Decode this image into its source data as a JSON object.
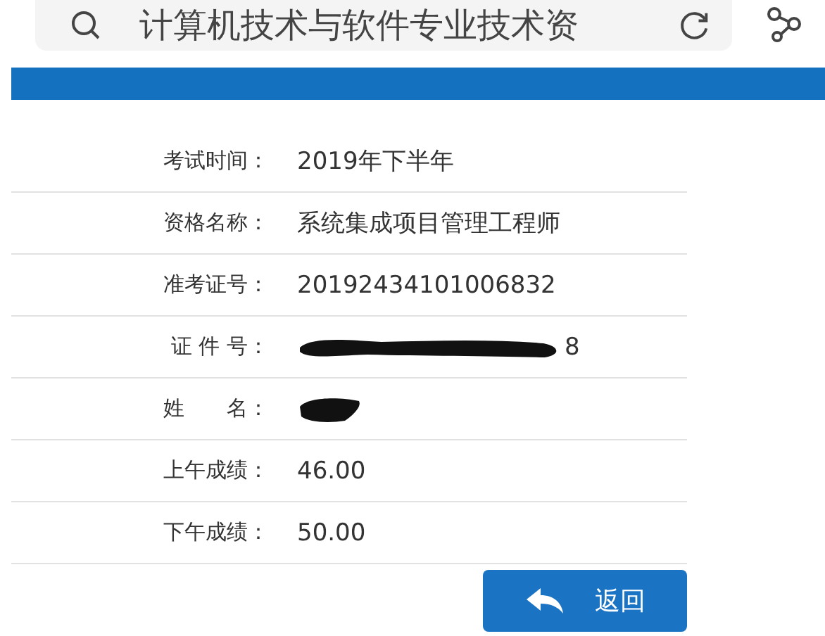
{
  "search": {
    "value": "计算机技术与软件专业技术资"
  },
  "rows": [
    {
      "label": "考试时间：",
      "kind": "text",
      "value": "2019年下半年"
    },
    {
      "label": "资格名称：",
      "kind": "text",
      "value": "系统集成项目管理工程师"
    },
    {
      "label": "准考证号：",
      "kind": "text",
      "value": "20192434101006832"
    },
    {
      "label": "证 件 号：",
      "kind": "redacted",
      "value": "8"
    },
    {
      "label": "姓　　名：",
      "kind": "redacted-short"
    },
    {
      "label": "上午成绩：",
      "kind": "text",
      "value": "46.00"
    },
    {
      "label": "下午成绩：",
      "kind": "text",
      "value": "50.00"
    }
  ],
  "back_button": {
    "label": "返回"
  }
}
